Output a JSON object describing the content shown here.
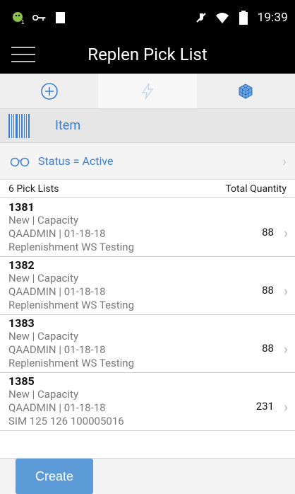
{
  "status_bar": {
    "clock": "19:39",
    "icons": [
      "android-notification-icon",
      "key-icon",
      "sd-card-icon",
      "mute-icon",
      "wifi-icon",
      "battery-icon"
    ]
  },
  "app_bar": {
    "title": "Replen Pick List",
    "menu_icon": "hamburger-menu-icon"
  },
  "toolbar": {
    "items": [
      {
        "icon": "add-circle-icon",
        "state": "enabled"
      },
      {
        "icon": "lightning-icon",
        "state": "disabled"
      },
      {
        "icon": "cube-icon",
        "state": "enabled"
      }
    ]
  },
  "search": {
    "label": "Item",
    "icon": "barcode-icon"
  },
  "filter": {
    "label": "Status = Active",
    "icon": "glasses-icon"
  },
  "list_header": {
    "count_label": "6 Pick Lists",
    "quantity_label": "Total Quantity"
  },
  "pick_lists": [
    {
      "id": "1381",
      "line1": "New | Capacity",
      "line2": "QAADMIN  |  01-18-18",
      "line3": "Replenishment WS Testing",
      "quantity": "88"
    },
    {
      "id": "1382",
      "line1": "New | Capacity",
      "line2": "QAADMIN  |  01-18-18",
      "line3": "Replenishment WS Testing",
      "quantity": "88"
    },
    {
      "id": "1383",
      "line1": "New | Capacity",
      "line2": "QAADMIN  |  01-18-18",
      "line3": "Replenishment WS Testing",
      "quantity": "88"
    },
    {
      "id": "1385",
      "line1": "New | Capacity",
      "line2": "QAADMIN  |  01-18-18",
      "line3": "SIM 125 126 100005016",
      "quantity": "231"
    }
  ],
  "footer": {
    "create_label": "Create"
  },
  "colors": {
    "accent": "#3b7fd0",
    "button": "#5d9ad8",
    "bar": "#000000",
    "android_green": "#8bc34a"
  }
}
